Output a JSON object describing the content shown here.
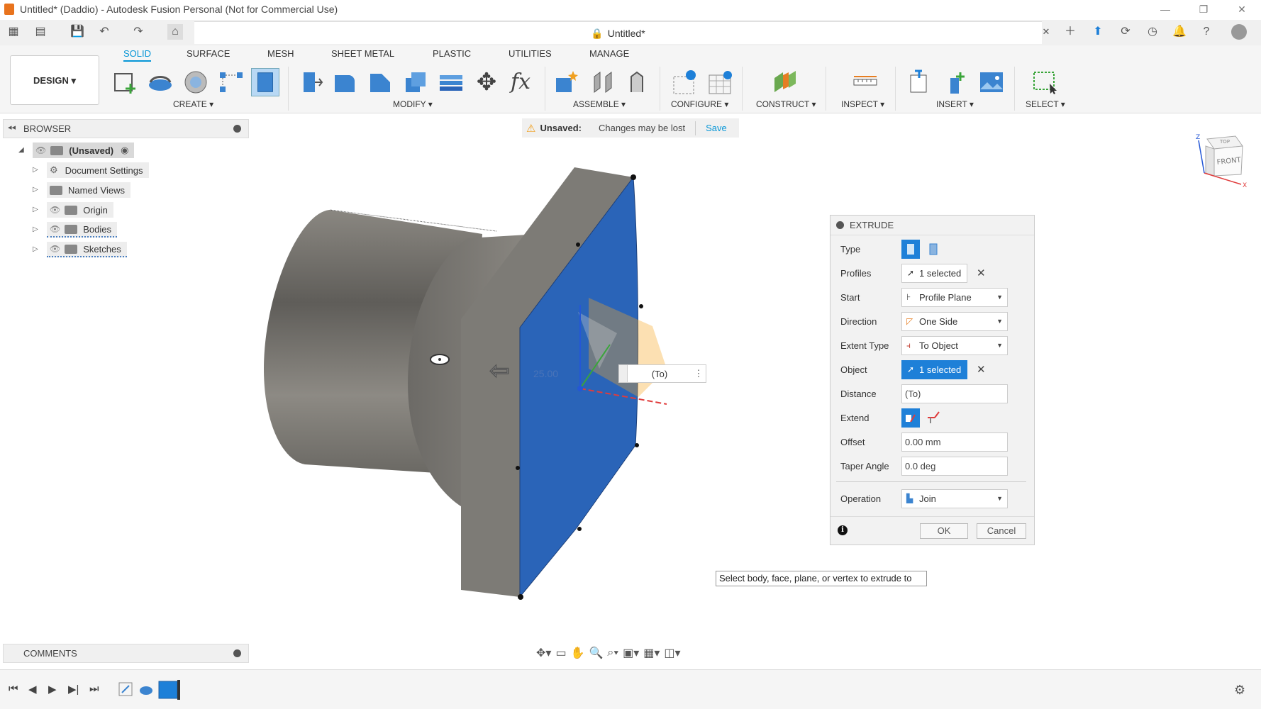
{
  "window": {
    "title": "Untitled* (Daddio) - Autodesk Fusion Personal (Not for Commercial Use)",
    "minimize": "—",
    "restore": "❐",
    "close": "✕"
  },
  "document_tab": {
    "title": "Untitled*"
  },
  "workspace": {
    "label": "DESIGN ▾"
  },
  "ribbon": {
    "tabs": [
      "SOLID",
      "SURFACE",
      "MESH",
      "SHEET METAL",
      "PLASTIC",
      "UTILITIES",
      "MANAGE"
    ],
    "active_tab": "SOLID",
    "groups": [
      "CREATE ▾",
      "MODIFY ▾",
      "ASSEMBLE ▾",
      "CONFIGURE ▾",
      "CONSTRUCT ▾",
      "INSPECT ▾",
      "INSERT ▾",
      "SELECT ▾"
    ]
  },
  "browser": {
    "title": "BROWSER",
    "root": "(Unsaved)",
    "items": [
      "Document Settings",
      "Named Views",
      "Origin",
      "Bodies",
      "Sketches"
    ]
  },
  "unsaved_bar": {
    "label": "Unsaved:",
    "message": "Changes may be lost",
    "save": "Save"
  },
  "viewcube": {
    "top": "TOP",
    "front": "FRONT",
    "axis_z": "Z",
    "axis_x": "X"
  },
  "viewport": {
    "dimension": "25.00",
    "to_label": "(To)"
  },
  "extrude": {
    "title": "EXTRUDE",
    "fields": {
      "type": "Type",
      "profiles": "Profiles",
      "start": "Start",
      "direction": "Direction",
      "extent_type": "Extent Type",
      "object": "Object",
      "distance": "Distance",
      "extend": "Extend",
      "offset": "Offset",
      "taper_angle": "Taper Angle",
      "operation": "Operation"
    },
    "values": {
      "profiles": "1 selected",
      "start": "Profile Plane",
      "direction": "One Side",
      "extent_type": "To Object",
      "object": "1 selected",
      "distance": "(To)",
      "offset": "0.00 mm",
      "taper_angle": "0.0 deg",
      "operation": "Join"
    },
    "ok": "OK",
    "cancel": "Cancel"
  },
  "tooltip": "Select body, face, plane, or vertex to extrude to",
  "comments": {
    "title": "COMMENTS"
  },
  "colors": {
    "accent": "#0696d7",
    "selection_blue": "#1e80d8",
    "face_blue": "#2a64b8",
    "body_gray": "#7d7b76"
  }
}
